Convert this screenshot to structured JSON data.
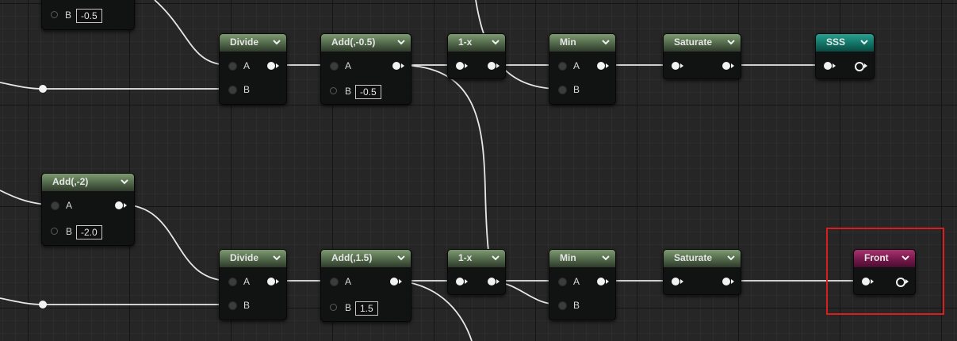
{
  "graph": {
    "nodes": {
      "top_partial": {
        "pin_b_label": "B",
        "pin_b_value": "-0.5"
      },
      "divide_top": {
        "title": "Divide",
        "pin_a": "A",
        "pin_b": "B"
      },
      "add_neg05": {
        "title": "Add(,-0.5)",
        "pin_a": "A",
        "pin_b": "B",
        "pin_b_value": "-0.5"
      },
      "oneminus_top": {
        "title": "1-x"
      },
      "min_top": {
        "title": "Min",
        "pin_a": "A",
        "pin_b": "B"
      },
      "saturate_top": {
        "title": "Saturate"
      },
      "sss": {
        "title": "SSS"
      },
      "add_neg2": {
        "title": "Add(,-2)",
        "pin_a": "A",
        "pin_b": "B",
        "pin_b_value": "-2.0"
      },
      "divide_bottom": {
        "title": "Divide",
        "pin_a": "A",
        "pin_b": "B"
      },
      "add_15": {
        "title": "Add(,1.5)",
        "pin_a": "A",
        "pin_b": "B",
        "pin_b_value": "1.5"
      },
      "oneminus_bottom": {
        "title": "1-x"
      },
      "min_bottom": {
        "title": "Min",
        "pin_a": "A",
        "pin_b": "B"
      },
      "saturate_bottom": {
        "title": "Saturate"
      },
      "front": {
        "title": "Front"
      }
    }
  },
  "colors": {
    "math_header": "#587050",
    "sss_header": "#13776a",
    "front_header": "#7a1a4f",
    "highlight": "#d81e1e",
    "wire": "#f2f2f2"
  }
}
